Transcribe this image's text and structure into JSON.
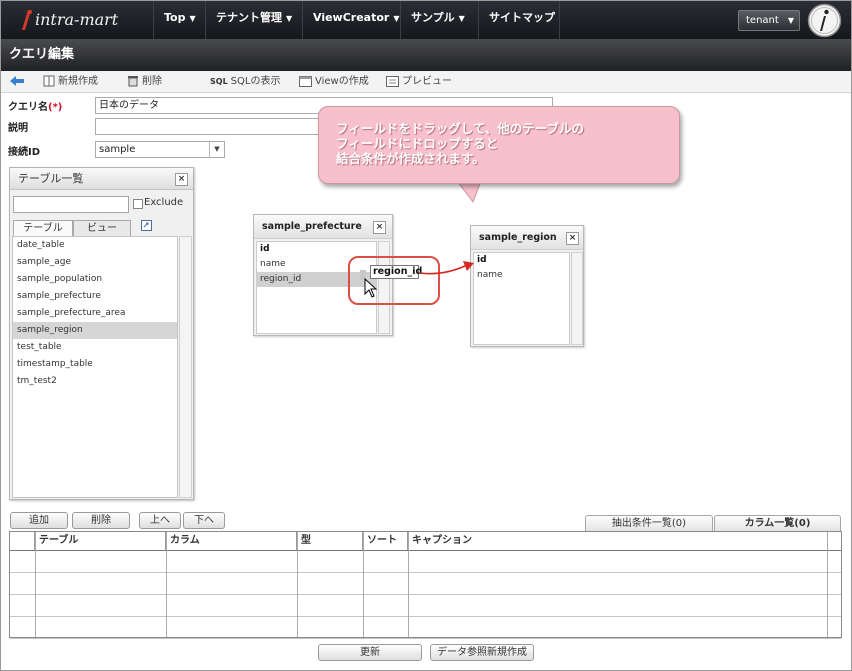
{
  "app": {
    "logo_text": "intra-mart",
    "tenant_label": "tenant"
  },
  "nav": {
    "items": [
      "Top",
      "テナント管理",
      "ViewCreator",
      "サンプル",
      "サイトマップ"
    ],
    "caret": "▼"
  },
  "page": {
    "title": "クエリ編集"
  },
  "toolbar": {
    "new_label": "新規作成",
    "delete_label": "削除",
    "sql_icon_label": "SQL",
    "sql_label": "SQLの表示",
    "view_label": "Viewの作成",
    "preview_label": "プレビュー"
  },
  "form": {
    "query_name_label": "クエリ名",
    "required_mark": "(*)",
    "query_name_value": "日本のデータ",
    "description_label": "説明",
    "description_value": "",
    "connection_label": "接続ID",
    "connection_value": "sample"
  },
  "table_panel": {
    "title": "テーブル一覧",
    "close": "×",
    "search_value": "",
    "exclude_label": "Exclude",
    "tabs": [
      "テーブル",
      "ビュー"
    ],
    "items": [
      "date_table",
      "sample_age",
      "sample_population",
      "sample_prefecture",
      "sample_prefecture_area",
      "sample_region",
      "test_table",
      "timestamp_table",
      "tm_test2"
    ],
    "selected_index": 5
  },
  "canvas": {
    "entities": [
      {
        "name": "sample_prefecture",
        "close": "×",
        "columns": [
          "id",
          "name",
          "region_id"
        ],
        "primary_key": "id",
        "highlighted": "region_id"
      },
      {
        "name": "sample_region",
        "close": "×",
        "columns": [
          "id",
          "name"
        ],
        "primary_key": "id"
      }
    ],
    "drag_label": "region_id"
  },
  "callout": {
    "lines": [
      "フィールドをドラッグして、他のテーブルの",
      "フィールドにドロップすると",
      "結合条件が作成されます。"
    ]
  },
  "buttons": {
    "add": "追加",
    "delete": "削除",
    "up": "上へ",
    "down": "下へ",
    "update": "更新",
    "create_reference": "データ参照新規作成"
  },
  "bottom_tabs": {
    "conditions": "抽出条件一覧(0)",
    "columns": "カラム一覧(0)"
  },
  "grid": {
    "headers": [
      "",
      "テーブル",
      "カラム",
      "型",
      "ソート",
      "キャプション"
    ],
    "row_count": 4
  },
  "colors": {
    "nav_bg": "#1c1e22",
    "callout_bg": "#f8c0cb",
    "highlight_ring": "#db4f44",
    "arrow": "#d42a22",
    "toolbar_back_arrow": "#3a7fd0"
  }
}
